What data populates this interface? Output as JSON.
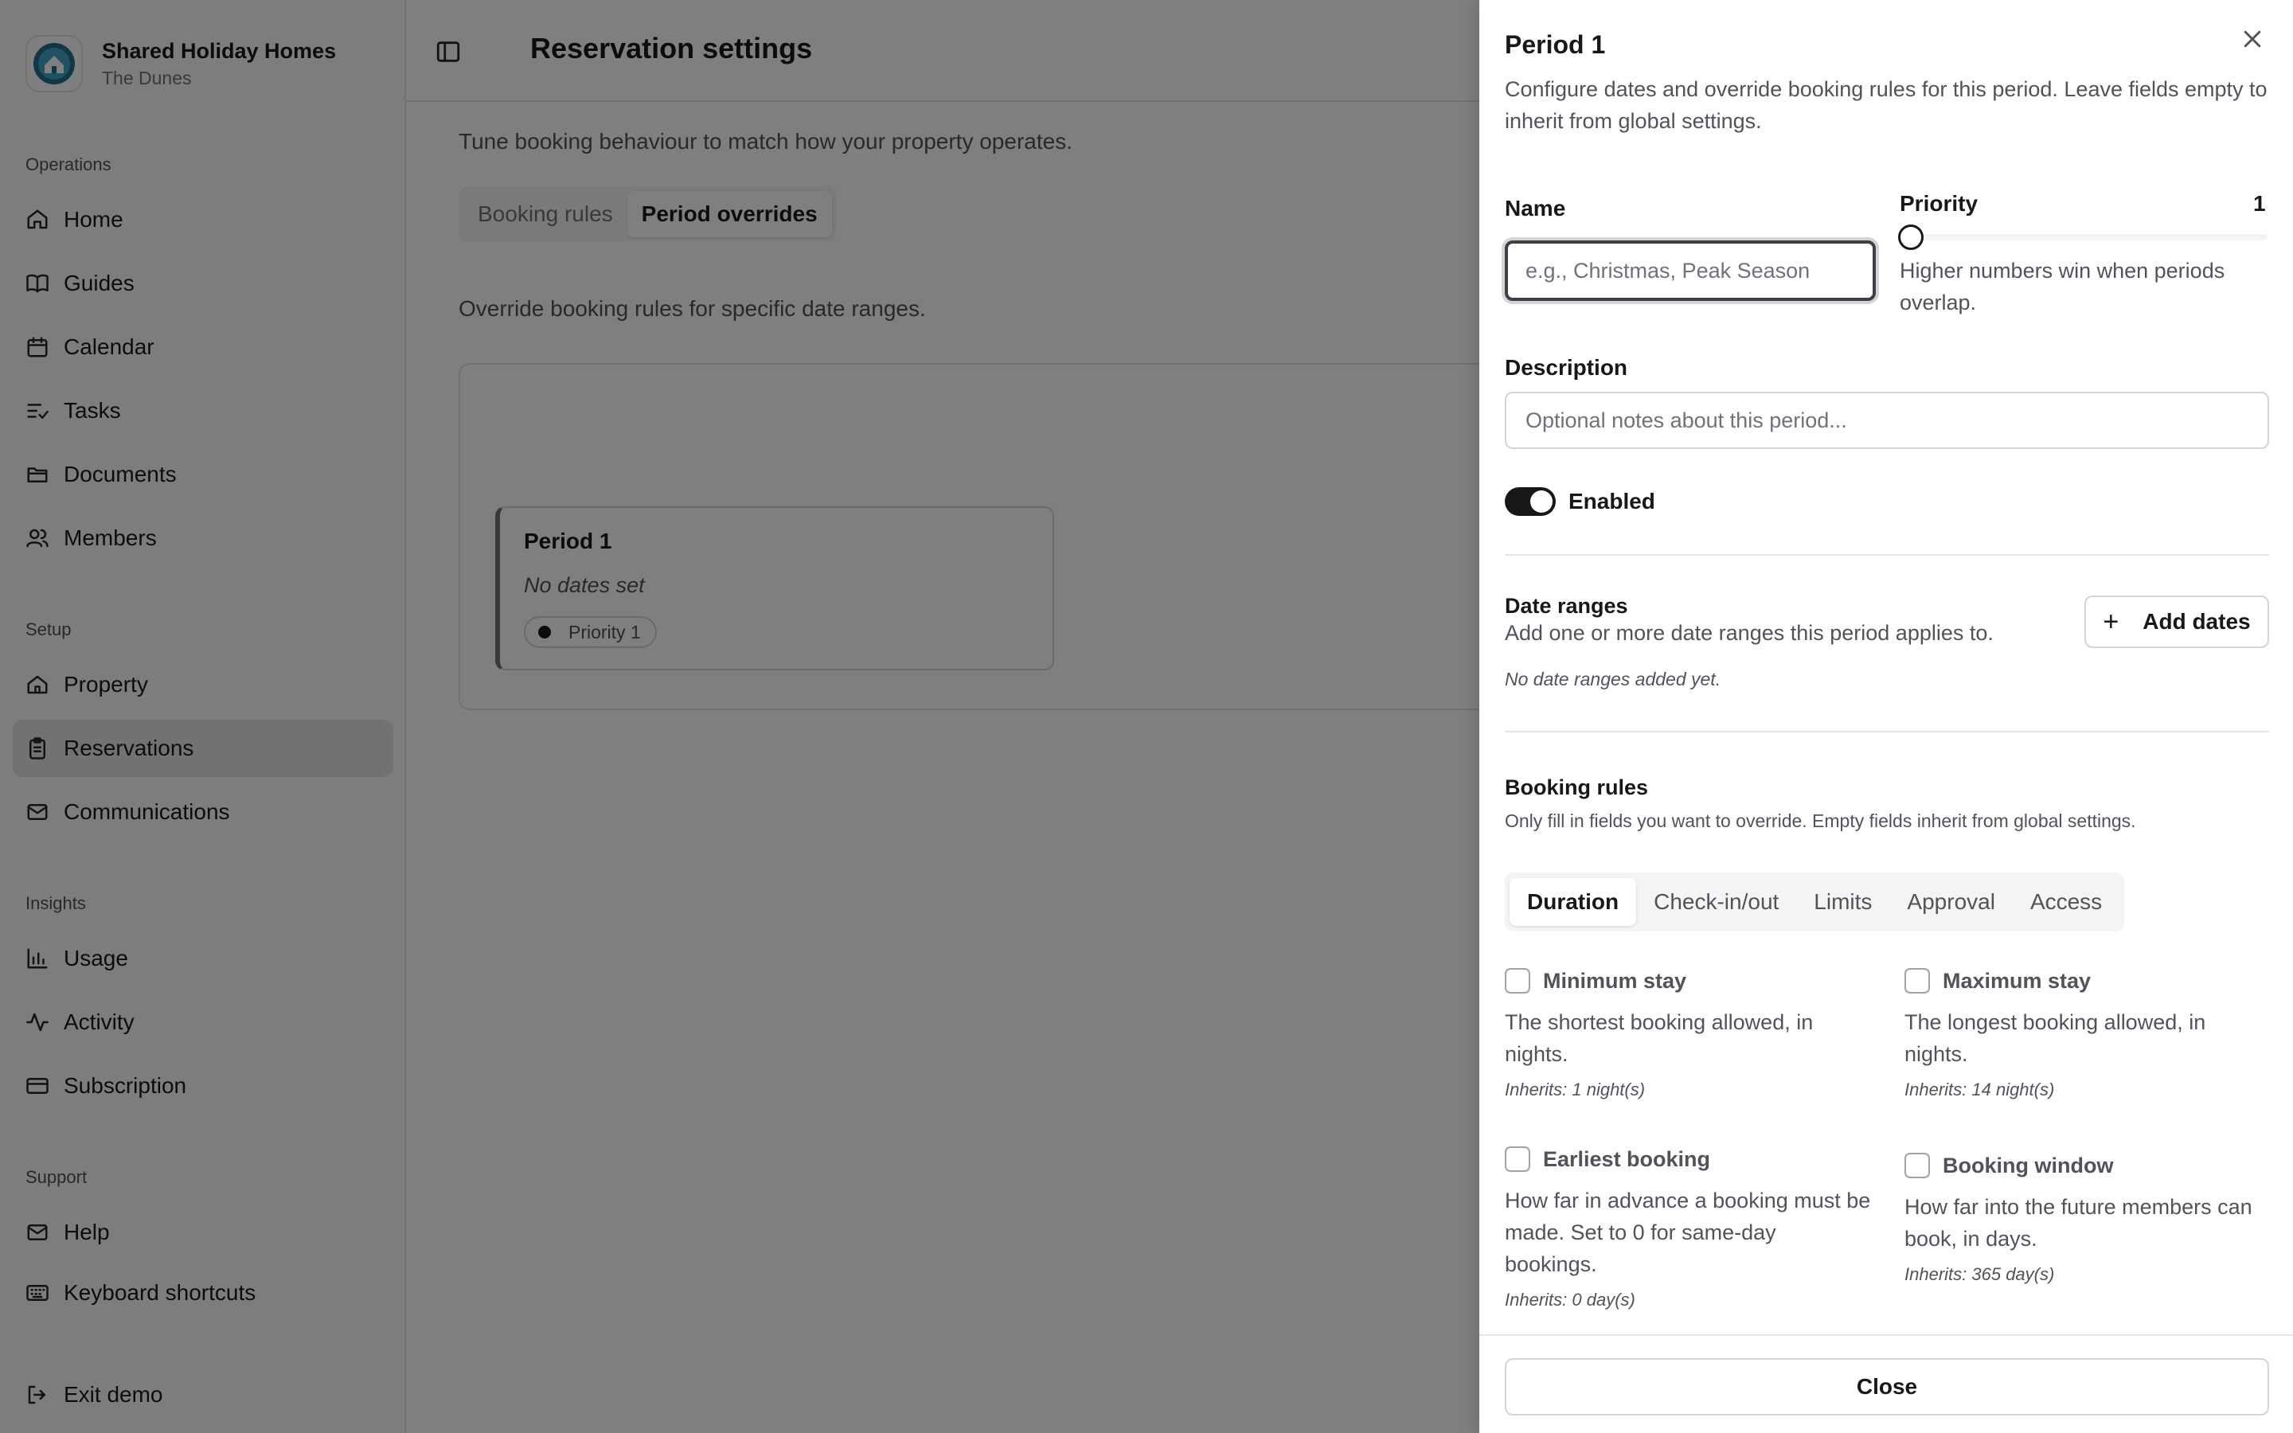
{
  "brand": {
    "name": "Shared Holiday Homes",
    "subtitle": "The Dunes"
  },
  "sidebar": {
    "groups": [
      {
        "label": "Operations",
        "items": [
          {
            "label": "Home",
            "icon": "home-icon"
          },
          {
            "label": "Guides",
            "icon": "book-icon"
          },
          {
            "label": "Calendar",
            "icon": "calendar-icon"
          },
          {
            "label": "Tasks",
            "icon": "tasks-icon"
          },
          {
            "label": "Documents",
            "icon": "folder-icon"
          },
          {
            "label": "Members",
            "icon": "users-icon"
          }
        ]
      },
      {
        "label": "Setup",
        "items": [
          {
            "label": "Property",
            "icon": "house-icon"
          },
          {
            "label": "Reservations",
            "icon": "clipboard-icon",
            "active": true
          },
          {
            "label": "Communications",
            "icon": "mail-icon"
          }
        ]
      },
      {
        "label": "Insights",
        "items": [
          {
            "label": "Usage",
            "icon": "bar-chart-icon"
          },
          {
            "label": "Activity",
            "icon": "activity-icon"
          },
          {
            "label": "Subscription",
            "icon": "credit-card-icon"
          }
        ]
      },
      {
        "label": "Support",
        "items": [
          {
            "label": "Help",
            "icon": "help-mail-icon"
          },
          {
            "label": "Keyboard shortcuts",
            "icon": "keyboard-icon"
          }
        ]
      }
    ],
    "exit": {
      "label": "Exit demo",
      "icon": "exit-icon"
    }
  },
  "main": {
    "title": "Reservation settings",
    "description": "Tune booking behaviour to match how your property operates.",
    "tabs": [
      {
        "label": "Booking rules"
      },
      {
        "label": "Period overrides",
        "active": true
      }
    ],
    "override_description": "Override booking rules for specific date ranges.",
    "period_card": {
      "title": "Period 1",
      "dates": "No dates set",
      "priority": "Priority 1"
    }
  },
  "drawer": {
    "title": "Period 1",
    "description": "Configure dates and override booking rules for this period. Leave fields empty to inherit from global settings.",
    "name": {
      "label": "Name",
      "value": "",
      "placeholder": "e.g., Christmas, Peak Season"
    },
    "priority": {
      "label": "Priority",
      "value": "1",
      "help": "Higher numbers win when periods overlap."
    },
    "description_field": {
      "label": "Description",
      "value": "",
      "placeholder": "Optional notes about this period..."
    },
    "enabled": {
      "label": "Enabled",
      "checked": true
    },
    "date_ranges": {
      "title": "Date ranges",
      "subtitle": "Add one or more date ranges this period applies to.",
      "add_label": "Add dates",
      "empty": "No date ranges added yet."
    },
    "booking_rules": {
      "title": "Booking rules",
      "subtitle": "Only fill in fields you want to override. Empty fields inherit from global settings.",
      "tabs": [
        {
          "label": "Duration",
          "active": true
        },
        {
          "label": "Check-in/out"
        },
        {
          "label": "Limits"
        },
        {
          "label": "Approval"
        },
        {
          "label": "Access"
        }
      ],
      "rules": [
        {
          "name": "Minimum stay",
          "help": "The shortest booking allowed, in nights.",
          "inherits": "Inherits: 1 night(s)"
        },
        {
          "name": "Maximum stay",
          "help": "The longest booking allowed, in nights.",
          "inherits": "Inherits: 14 night(s)"
        },
        {
          "name": "Earliest booking",
          "help": "How far in advance a booking must be made. Set to 0 for same-day bookings.",
          "inherits": "Inherits: 0 day(s)"
        },
        {
          "name": "Booking window",
          "help": "How far into the future members can book, in days.",
          "inherits": "Inherits: 365 day(s)"
        }
      ]
    },
    "close_label": "Close"
  }
}
